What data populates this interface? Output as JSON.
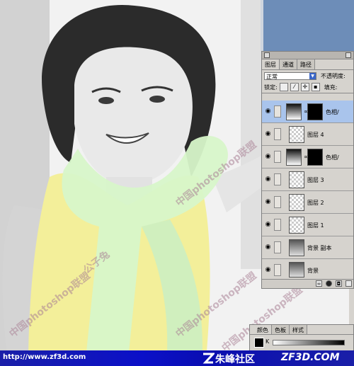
{
  "photo": {
    "watermarks": [
      "中国photoshop联盟",
      "中国photoshop联盟",
      "中国photoshop联盟",
      "中国photoshop联盟"
    ],
    "signature": "公子兔"
  },
  "layers_panel": {
    "tabs": [
      "图层",
      "通道",
      "路径"
    ],
    "blend_mode": "正常",
    "opacity_label": "不透明度:",
    "lock_label": "锁定:",
    "fill_label": "填充:",
    "layers": [
      {
        "name": "色相/",
        "selected": true
      },
      {
        "name": "图层 4",
        "selected": false
      },
      {
        "name": "色相/",
        "selected": false
      },
      {
        "name": "图层 3",
        "selected": false
      },
      {
        "name": "图层 2",
        "selected": false
      },
      {
        "name": "图层 1",
        "selected": false
      },
      {
        "name": "背景 副本",
        "selected": false
      },
      {
        "name": "背景",
        "selected": false
      }
    ]
  },
  "color_panel": {
    "tabs": [
      "颜色",
      "色板",
      "样式"
    ],
    "channel_label": "K"
  },
  "footer": {
    "url": "http://www.zf3d.com",
    "site_name": "朱峰社区",
    "brand": "ZF3D.COM"
  },
  "colors": {
    "selection": "#a9c4ec",
    "panel": "#d6d3ce",
    "footer_blue": "#0b10c8",
    "blend_arrow": "#3a66c8"
  }
}
